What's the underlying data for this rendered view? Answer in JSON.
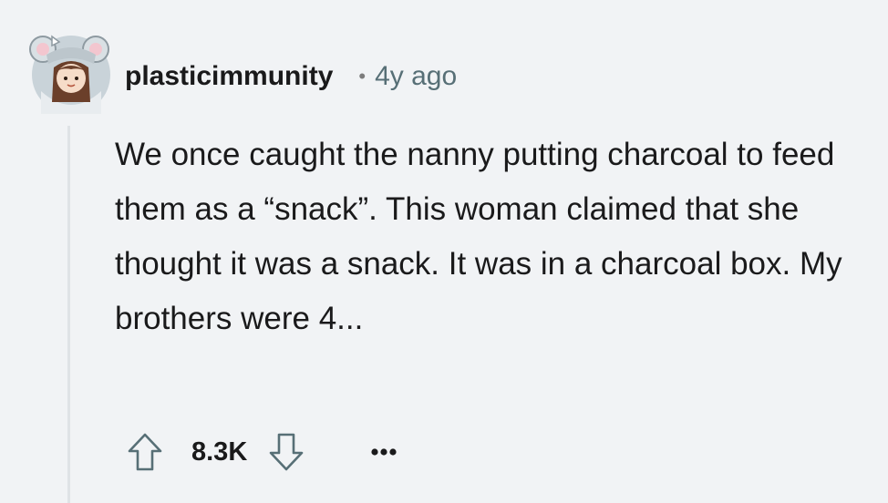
{
  "comment": {
    "username": "plasticimmunity",
    "separator": "•",
    "timestamp": "4y ago",
    "body": "We once caught the nanny putting charcoal to feed them as a “snack”. This woman claimed that she thought it was a snack. It was in a charcoal box. My brothers were 4...",
    "avatar_icon": "user-avatar-icon",
    "colors": {
      "background": "#f1f3f5",
      "text": "#1a1a1b",
      "meta": "#576f76",
      "thread_line": "#dfe3e6"
    }
  },
  "actions": {
    "score": "8.3K",
    "upvote_icon": "upvote-arrow-icon",
    "downvote_icon": "downvote-arrow-icon",
    "more_icon": "more-options-icon"
  }
}
